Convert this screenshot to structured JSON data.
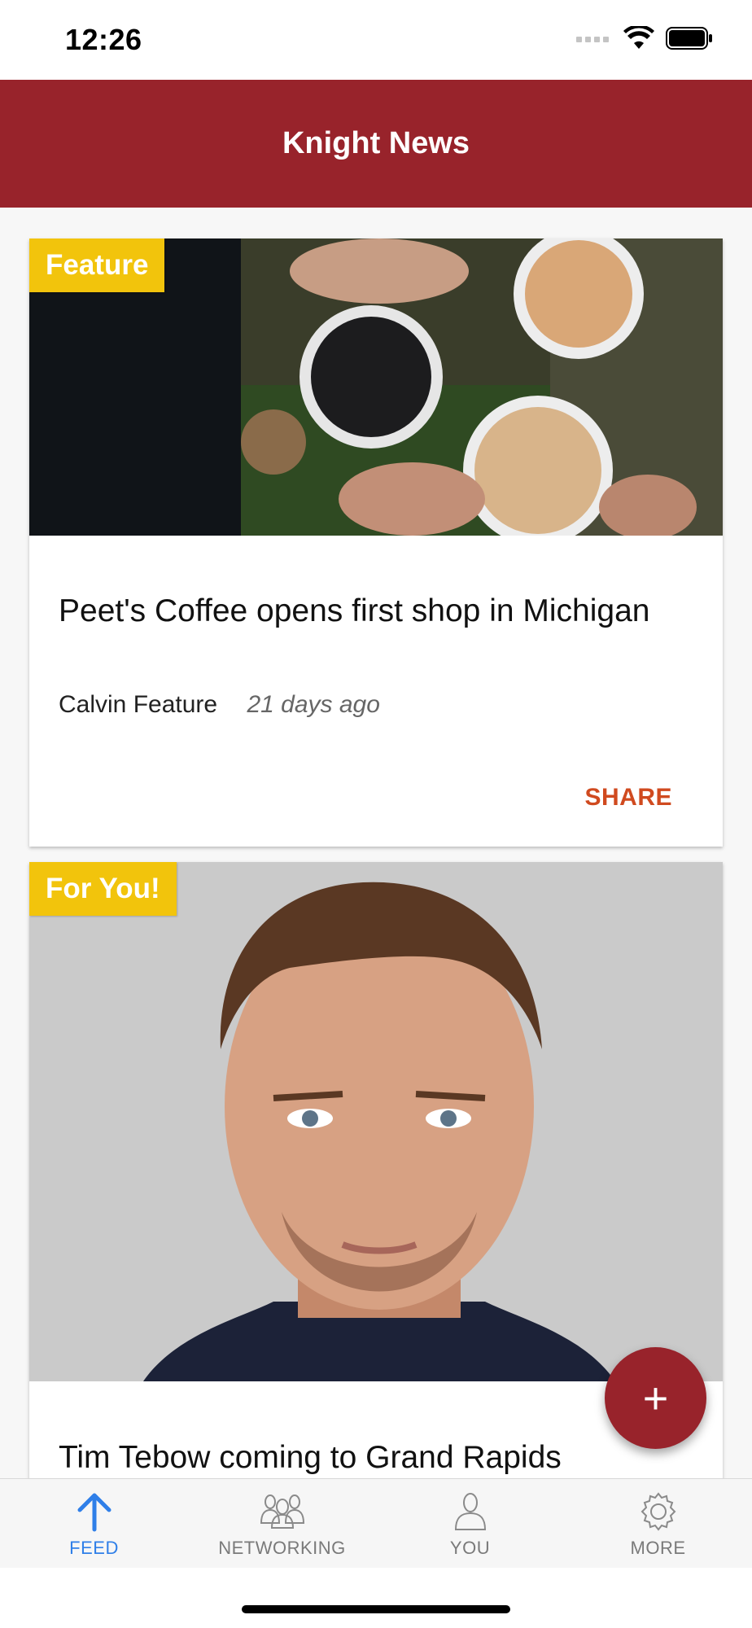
{
  "status": {
    "time": "12:26"
  },
  "header": {
    "title": "Knight News"
  },
  "cards": [
    {
      "badge": "Feature",
      "title": "Peet's Coffee opens first shop in Michigan",
      "author": "Calvin Feature",
      "date": "21 days ago",
      "share_label": "SHARE"
    },
    {
      "badge": "For You!",
      "title": "Tim Tebow coming to Grand Rapids"
    }
  ],
  "fab": {
    "label": "+"
  },
  "tabs": [
    {
      "label": "FEED",
      "icon": "arrow-up-icon",
      "active": true
    },
    {
      "label": "NETWORKING",
      "icon": "people-icon",
      "active": false
    },
    {
      "label": "YOU",
      "icon": "person-icon",
      "active": false
    },
    {
      "label": "MORE",
      "icon": "gear-icon",
      "active": false
    }
  ],
  "colors": {
    "header": "#98232b",
    "badge": "#f2c40c",
    "share": "#d04a1f",
    "active_tab": "#2f7fe8"
  }
}
